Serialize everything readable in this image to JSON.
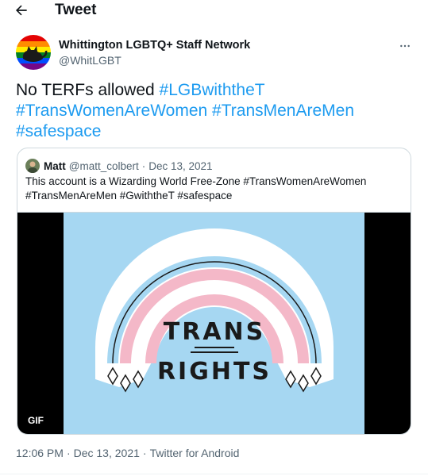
{
  "header": {
    "title": "Tweet",
    "back_icon": "arrow-left-icon"
  },
  "author": {
    "display_name": "Whittington LGBTQ+ Staff Network",
    "handle": "@WhitLGBT"
  },
  "tweet": {
    "text_plain": "No TERFs allowed ",
    "hashtags": [
      "#LGBwiththeT",
      "#TransWomenAreWomen",
      "#TransMenAreMen",
      "#safespace"
    ]
  },
  "quote": {
    "name": "Matt",
    "handle": "@matt_colbert",
    "separator": "·",
    "date": "Dec 13, 2021",
    "text": "This account is a Wizarding World Free-Zone #TransWomenAreWomen #TransMenAreMen #GwiththeT #safespace",
    "media": {
      "badge": "GIF",
      "sticker_line1": "TRANS",
      "sticker_line2": "RIGHTS",
      "rainbow_colors": [
        "#a6d7f2",
        "#f4b8c8",
        "#ffffff"
      ]
    }
  },
  "meta": {
    "time": "12:06 PM",
    "separator1": "·",
    "date": "Dec 13, 2021",
    "separator2": "·",
    "source": "Twitter for Android"
  },
  "colors": {
    "link": "#1d9bf0",
    "secondary": "#536471",
    "border": "#cfd9de"
  }
}
